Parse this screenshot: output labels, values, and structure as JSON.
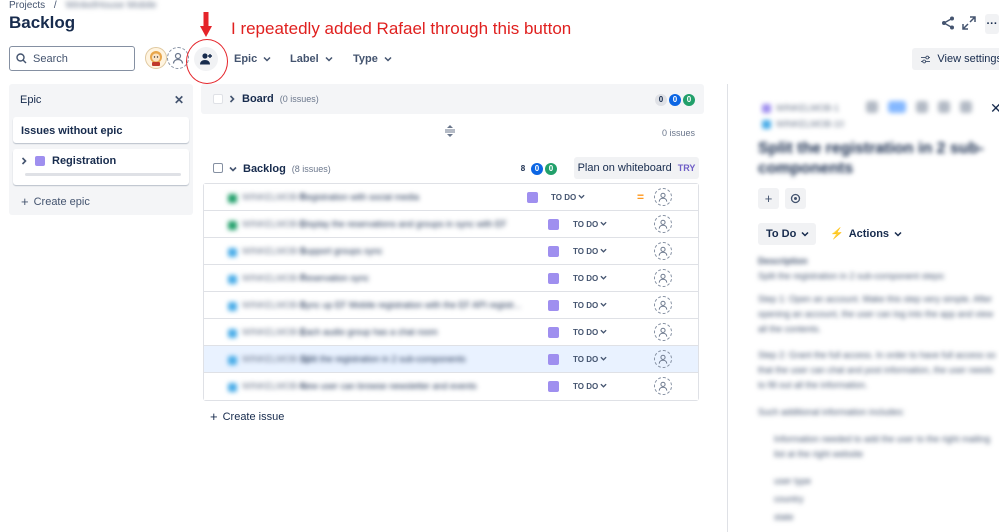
{
  "breadcrumb": {
    "projects": "Projects",
    "separator": "/",
    "project": "WinkelHouse Mobile"
  },
  "page": {
    "title": "Backlog"
  },
  "annotation": {
    "text": "I repeatedly added Rafael through this button",
    "color": "#e0201f"
  },
  "toolbar": {
    "search_placeholder": "Search",
    "filters": [
      {
        "label": "Epic"
      },
      {
        "label": "Label"
      },
      {
        "label": "Type"
      }
    ],
    "view_settings": "View settings"
  },
  "epic_panel": {
    "title": "Epic",
    "issues_without_epic": "Issues without epic",
    "epic_name": "Registration",
    "create_epic": "Create epic"
  },
  "board": {
    "name": "Board",
    "count": "(0 issues)",
    "pills": [
      "0",
      "0",
      "0"
    ],
    "empty": "0 issues"
  },
  "backlog": {
    "name": "Backlog",
    "count": "(8 issues)",
    "pills": [
      "8",
      "0",
      "0"
    ],
    "plan_button": "Plan on whiteboard",
    "plan_badge": "TRY",
    "create_issue": "Create issue",
    "issues": [
      {
        "key": "WINKELMOB-5",
        "summary": "Registration with social media",
        "status": "TO DO",
        "type_color": "#22a06b",
        "priority": true,
        "selected": false
      },
      {
        "key": "WINKELMOB-6",
        "summary": "Display the reservations and groups in sync with EF",
        "status": "TO DO",
        "type_color": "#22a06b",
        "priority": false,
        "selected": false
      },
      {
        "key": "WINKELMOB-9",
        "summary": "Support groups sync",
        "status": "TO DO",
        "type_color": "#4bade8",
        "priority": false,
        "selected": false
      },
      {
        "key": "WINKELMOB-7",
        "summary": "Reservation sync",
        "status": "TO DO",
        "type_color": "#4bade8",
        "priority": false,
        "selected": false
      },
      {
        "key": "WINKELMOB-8",
        "summary": "Sync up EF Mobile registration with the EF API registr...",
        "status": "TO DO",
        "type_color": "#4bade8",
        "priority": false,
        "selected": false
      },
      {
        "key": "WINKELMOB-3",
        "summary": "Each audio group has a chat room",
        "status": "TO DO",
        "type_color": "#4bade8",
        "priority": false,
        "selected": false
      },
      {
        "key": "WINKELMOB-10",
        "summary": "Split the registration in 2 sub-components",
        "status": "TO DO",
        "type_color": "#4bade8",
        "priority": false,
        "selected": true
      },
      {
        "key": "WINKELMOB-4",
        "summary": "New user can browse newsletter and events",
        "status": "TO DO",
        "type_color": "#4bade8",
        "priority": false,
        "selected": false
      }
    ]
  },
  "detail": {
    "breadcrumb_1": "WINKELMOB-1",
    "breadcrumb_2": "WINKELMOB-10",
    "title": "Split the registration in 2 sub-components",
    "status": "To Do",
    "actions": "Actions",
    "description_label": "Description",
    "p1": "Split the registration in 2 sub-component steps:",
    "p2": "Step 1: Open an account. Make this step very simple. After opening an account, the user can log into the app and view all the contents.",
    "p3": "Step 2: Grant the full access. In order to have full access so that the user can chat and post information, the user needs to fill out all the information.",
    "p4": "Such additional information includes:",
    "li1": "Information needed to add the user to the right mailing list at the right website",
    "li2": "user type",
    "li3": "country",
    "li4": "state"
  }
}
